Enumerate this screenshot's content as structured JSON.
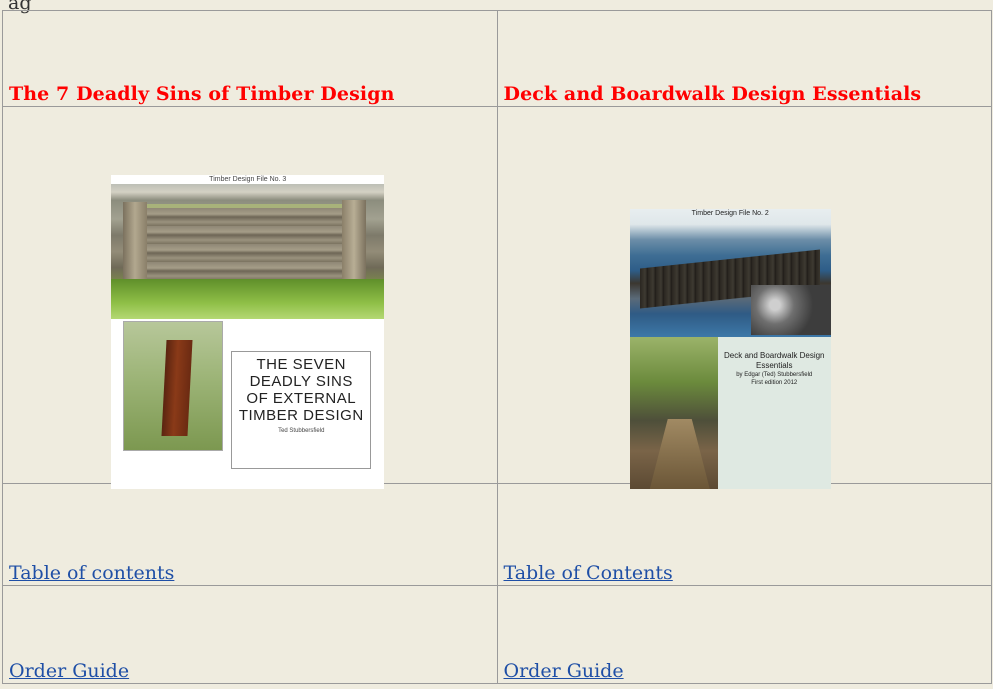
{
  "page": {
    "top_text": "ag"
  },
  "books": [
    {
      "title": "The 7 Deadly Sins of Timber Design",
      "cover": {
        "series_line": "Timber Design File No. 3",
        "title_text": "THE SEVEN DEADLY SINS OF EXTERNAL TIMBER DESIGN",
        "author": "Ted Stubbersfield"
      },
      "toc_link": "Table of contents",
      "order_link": "Order Guide"
    },
    {
      "title": "Deck and Boardwalk Design Essentials",
      "cover": {
        "series_line": "Timber Design File No. 2",
        "title_text": "Deck and Boardwalk Design Essentials",
        "author": "by Edgar (Ted) Stubbersfield",
        "edition": "First edition 2012"
      },
      "toc_link": "Table of Contents",
      "order_link": "Order Guide"
    }
  ],
  "colors": {
    "background": "#efecdf",
    "title_red": "#ff0000",
    "link_blue": "#1f4fa6",
    "border": "#9a9a9a"
  }
}
